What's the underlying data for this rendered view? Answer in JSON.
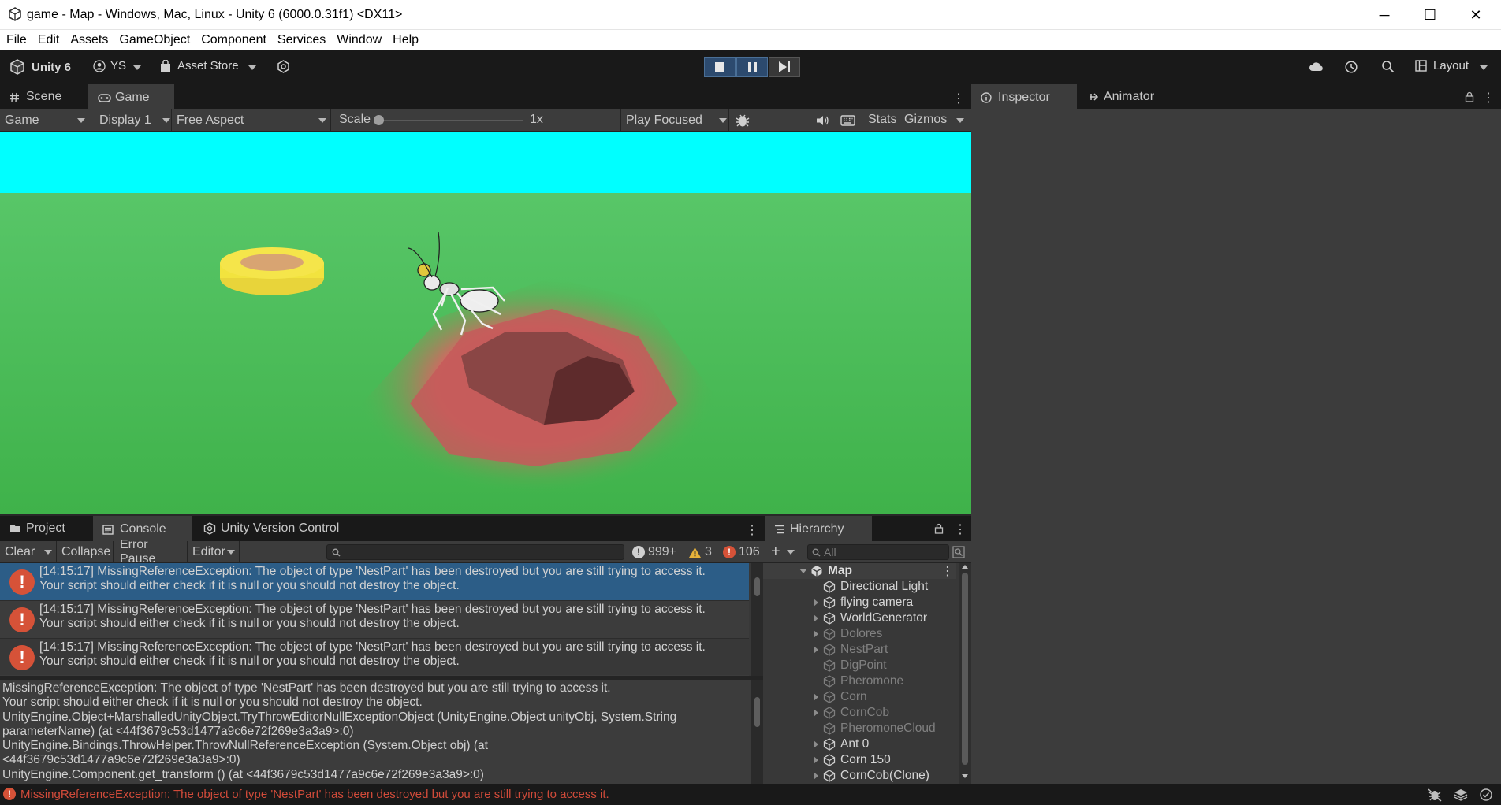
{
  "window": {
    "title": "game - Map - Windows, Mac, Linux - Unity 6 (6000.0.31f1) <DX11>",
    "minimize_glyph": "─",
    "maximize_glyph": "☐",
    "close_glyph": "✕"
  },
  "menu": [
    "File",
    "Edit",
    "Assets",
    "GameObject",
    "Component",
    "Services",
    "Window",
    "Help"
  ],
  "toolbar": {
    "unity_label": "Unity 6",
    "account_label": "YS",
    "asset_store_label": "Asset Store",
    "layout_label": "Layout"
  },
  "scene_panel": {
    "tabs": [
      "Scene",
      "Game"
    ],
    "active_tab": "Game",
    "game_dropdown": "Game",
    "display_dropdown": "Display 1",
    "aspect_dropdown": "Free Aspect",
    "scale_label": "Scale",
    "scale_value": "1x",
    "scale_level": 0.0,
    "play_mode_dropdown": "Play Focused",
    "stats_label": "Stats",
    "gizmos_label": "Gizmos"
  },
  "game_view_colors": {
    "sky": "#00ffff",
    "ground": "#46b84f",
    "nest": "#c8605e",
    "corn": "#f0e040"
  },
  "inspector": {
    "tabs": [
      "Inspector",
      "Animator"
    ],
    "active_tab": "Inspector"
  },
  "console_panel": {
    "tabs": [
      "Project",
      "Console",
      "Unity Version Control"
    ],
    "active_tab": "Console",
    "clear_label": "Clear",
    "collapse_label": "Collapse",
    "error_pause_label": "Error Pause",
    "editor_label": "Editor",
    "log_count": "999+",
    "warn_count": "3",
    "error_count": "106",
    "rows": [
      {
        "line1": "[14:15:17] MissingReferenceException: The object of type 'NestPart' has been destroyed but you are still trying to access it.",
        "line2": "Your script should either check if it is null or you should not destroy the object.",
        "selected": true
      },
      {
        "line1": "[14:15:17] MissingReferenceException: The object of type 'NestPart' has been destroyed but you are still trying to access it.",
        "line2": "Your script should either check if it is null or you should not destroy the object.",
        "selected": false
      },
      {
        "line1": "[14:15:17] MissingReferenceException: The object of type 'NestPart' has been destroyed but you are still trying to access it.",
        "line2": "Your script should either check if it is null or you should not destroy the object.",
        "selected": false
      }
    ],
    "detail_lines": [
      "MissingReferenceException: The object of type 'NestPart' has been destroyed but you are still trying to access it.",
      "Your script should either check if it is null or you should not destroy the object.",
      "UnityEngine.Object+MarshalledUnityObject.TryThrowEditorNullExceptionObject (UnityEngine.Object unityObj, System.String",
      "parameterName) (at <44f3679c53d1477a9c6e72f269e3a3a9>:0)",
      "UnityEngine.Bindings.ThrowHelper.ThrowNullReferenceException (System.Object obj) (at",
      "<44f3679c53d1477a9c6e72f269e3a3a9>:0)",
      "UnityEngine.Component.get_transform () (at <44f3679c53d1477a9c6e72f269e3a3a9>:0)"
    ]
  },
  "hierarchy": {
    "tab_label": "Hierarchy",
    "search_placeholder": "All",
    "root": "Map",
    "items": [
      {
        "label": "Directional Light",
        "expandable": false,
        "active": true
      },
      {
        "label": "flying camera",
        "expandable": true,
        "active": true
      },
      {
        "label": "WorldGenerator",
        "expandable": true,
        "active": true
      },
      {
        "label": "Dolores",
        "expandable": true,
        "active": false
      },
      {
        "label": "NestPart",
        "expandable": true,
        "active": false
      },
      {
        "label": "DigPoint",
        "expandable": false,
        "active": false
      },
      {
        "label": "Pheromone",
        "expandable": false,
        "active": false
      },
      {
        "label": "Corn",
        "expandable": true,
        "active": false
      },
      {
        "label": "CornCob",
        "expandable": true,
        "active": false
      },
      {
        "label": "PheromoneCloud",
        "expandable": false,
        "active": false
      },
      {
        "label": "Ant 0",
        "expandable": true,
        "active": true
      },
      {
        "label": "Corn 150",
        "expandable": true,
        "active": true
      },
      {
        "label": "CornCob(Clone)",
        "expandable": true,
        "active": true
      }
    ]
  },
  "status_bar": {
    "message": "MissingReferenceException: The object of type 'NestPart' has been destroyed but you are still trying to access it."
  }
}
